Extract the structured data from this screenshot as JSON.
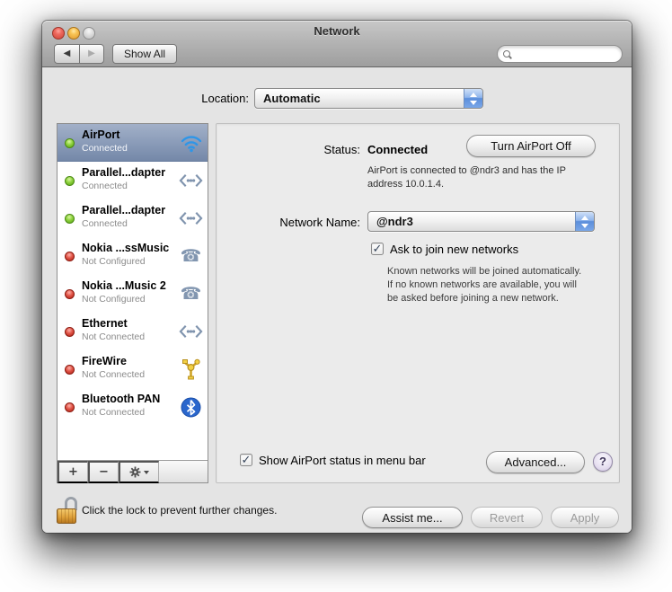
{
  "window": {
    "title": "Network",
    "toolbar": {
      "show_all_label": "Show All",
      "search_placeholder": ""
    }
  },
  "glyphs": {
    "back": "◀",
    "forward": "▶",
    "check": "✓",
    "add": "+",
    "remove": "−",
    "help": "?",
    "phone": "☎"
  },
  "location": {
    "label": "Location:",
    "value": "Automatic"
  },
  "sidebar": {
    "items": [
      {
        "name": "AirPort",
        "status": "Connected",
        "state": "connected",
        "icon": "wifi",
        "selected": true
      },
      {
        "name": "Parallel...dapter",
        "status": "Connected",
        "state": "connected",
        "icon": "ethernet",
        "selected": false
      },
      {
        "name": "Parallel...dapter",
        "status": "Connected",
        "state": "connected",
        "icon": "ethernet",
        "selected": false
      },
      {
        "name": "Nokia ...ssMusic",
        "status": "Not Configured",
        "state": "not_configured",
        "icon": "phone",
        "selected": false
      },
      {
        "name": "Nokia ...Music 2",
        "status": "Not Configured",
        "state": "not_configured",
        "icon": "phone",
        "selected": false
      },
      {
        "name": "Ethernet",
        "status": "Not Connected",
        "state": "not_connected",
        "icon": "ethernet",
        "selected": false
      },
      {
        "name": "FireWire",
        "status": "Not Connected",
        "state": "not_connected",
        "icon": "firewire",
        "selected": false
      },
      {
        "name": "Bluetooth PAN",
        "status": "Not Connected",
        "state": "not_connected",
        "icon": "bluetooth",
        "selected": false
      }
    ]
  },
  "panel": {
    "status_label": "Status:",
    "status_value": "Connected",
    "turn_off_button_label": "Turn AirPort Off",
    "status_description_lines": [
      "AirPort is connected to @ndr3 and has the IP",
      "address 10.0.1.4."
    ],
    "network_name_label": "Network Name:",
    "network_name_value": "@ndr3",
    "ask_to_join_label": "Ask to join new networks",
    "ask_to_join_checked": true,
    "ask_to_join_help_lines": [
      "Known networks will be joined automatically.",
      "If no known networks are available, you will",
      "be asked before joining a new network."
    ],
    "menu_bar_label": "Show AirPort status in menu bar",
    "menu_bar_checked": true,
    "advanced_button_label": "Advanced..."
  },
  "footer": {
    "lock_text": "Click the lock to prevent further changes.",
    "assist_button_label": "Assist me...",
    "revert_button_label": "Revert",
    "apply_button_label": "Apply"
  },
  "colors": {
    "selection_top": "#a2b0c8",
    "selection_bottom": "#7488a8",
    "connected_dot": "#55a214",
    "not_connected_dot": "#b01e12",
    "popup_cap_blue": "#5b8edb",
    "wifi_blue": "#2e96e8",
    "bluetooth_blue": "#2a66cc",
    "firewire_gold": "#e8bc3a",
    "lock_gold": "#dfa23c"
  }
}
